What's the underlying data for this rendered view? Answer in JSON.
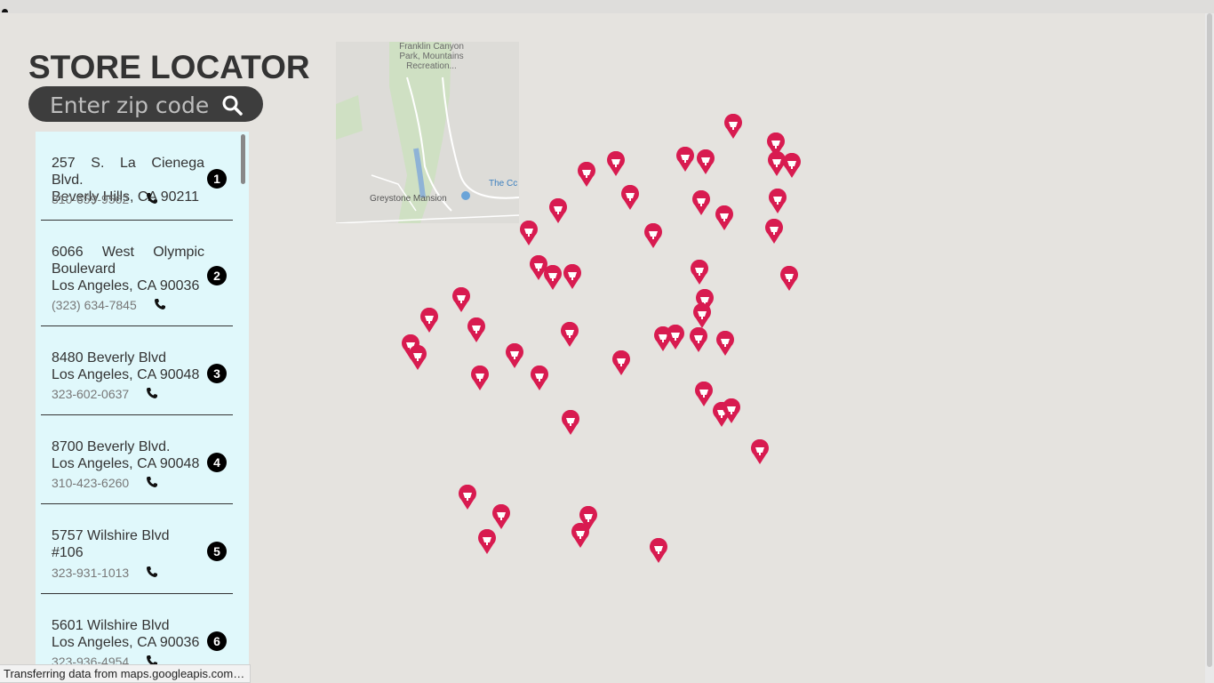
{
  "header": {
    "title": "STORE LOCATOR"
  },
  "search": {
    "placeholder": "Enter zip code",
    "value": ""
  },
  "map": {
    "tile_labels": [
      "Franklin Canyon Park, Mountains Recreation...",
      "Greystone Mansion",
      "The Cc"
    ],
    "marker_count": 52,
    "colors": {
      "marker": "#d81b50",
      "background": "#e5e3df",
      "panel": "#e0f8fb"
    }
  },
  "stores": [
    {
      "number": "1",
      "address_line1": "257 S. La Cienega Blvd.",
      "address_line2": "Beverly Hills, CA 90211",
      "phone": "310-659-9562"
    },
    {
      "number": "2",
      "address_line1": "6066 West Olympic Boulevard",
      "address_line2": "Los Angeles, CA 90036",
      "phone": "(323) 634-7845"
    },
    {
      "number": "3",
      "address_line1": "8480 Beverly Blvd",
      "address_line2": "Los Angeles, CA 90048",
      "phone": "323-602-0637"
    },
    {
      "number": "4",
      "address_line1": "8700 Beverly Blvd.",
      "address_line2": "Los Angeles, CA 90048",
      "phone": "310-423-6260"
    },
    {
      "number": "5",
      "address_line1": "5757 Wilshire Blvd #106",
      "address_line2": "",
      "phone": "323-931-1013"
    },
    {
      "number": "6",
      "address_line1": "5601 Wilshire Blvd",
      "address_line2": "Los Angeles, CA 90036",
      "phone": "323-936-4954"
    }
  ],
  "status_bar": {
    "text": "Transferring data from maps.googleapis.com…"
  }
}
